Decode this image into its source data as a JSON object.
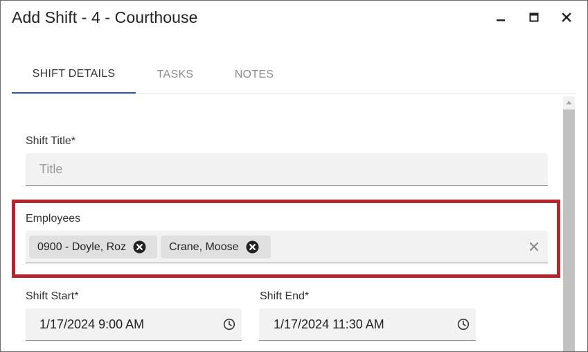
{
  "window": {
    "title": "Add Shift - 4 - Courthouse"
  },
  "tabs": [
    {
      "label": "SHIFT DETAILS",
      "active": true
    },
    {
      "label": "TASKS",
      "active": false
    },
    {
      "label": "NOTES",
      "active": false
    }
  ],
  "shift_title": {
    "label": "Shift Title*",
    "placeholder": "Title",
    "value": ""
  },
  "employees": {
    "label": "Employees",
    "chips": [
      {
        "label": "0900 - Doyle, Roz"
      },
      {
        "label": "Crane, Moose"
      }
    ]
  },
  "shift_start": {
    "label": "Shift Start*",
    "value": "1/17/2024 9:00 AM"
  },
  "shift_end": {
    "label": "Shift End*",
    "value": "1/17/2024 11:30 AM"
  },
  "icons": {
    "minimize": "minimize-icon",
    "maximize": "maximize-icon",
    "close": "close-icon",
    "chip_remove": "cancel-circle-icon",
    "clear": "clear-icon",
    "clock": "clock-icon",
    "scroll_up": "arrow-up-icon"
  },
  "colors": {
    "active_tab": "#2f5aa6",
    "highlight": "#b3262d",
    "field_bg": "#f2f2f2",
    "chip_bg": "#e0e0e0"
  }
}
